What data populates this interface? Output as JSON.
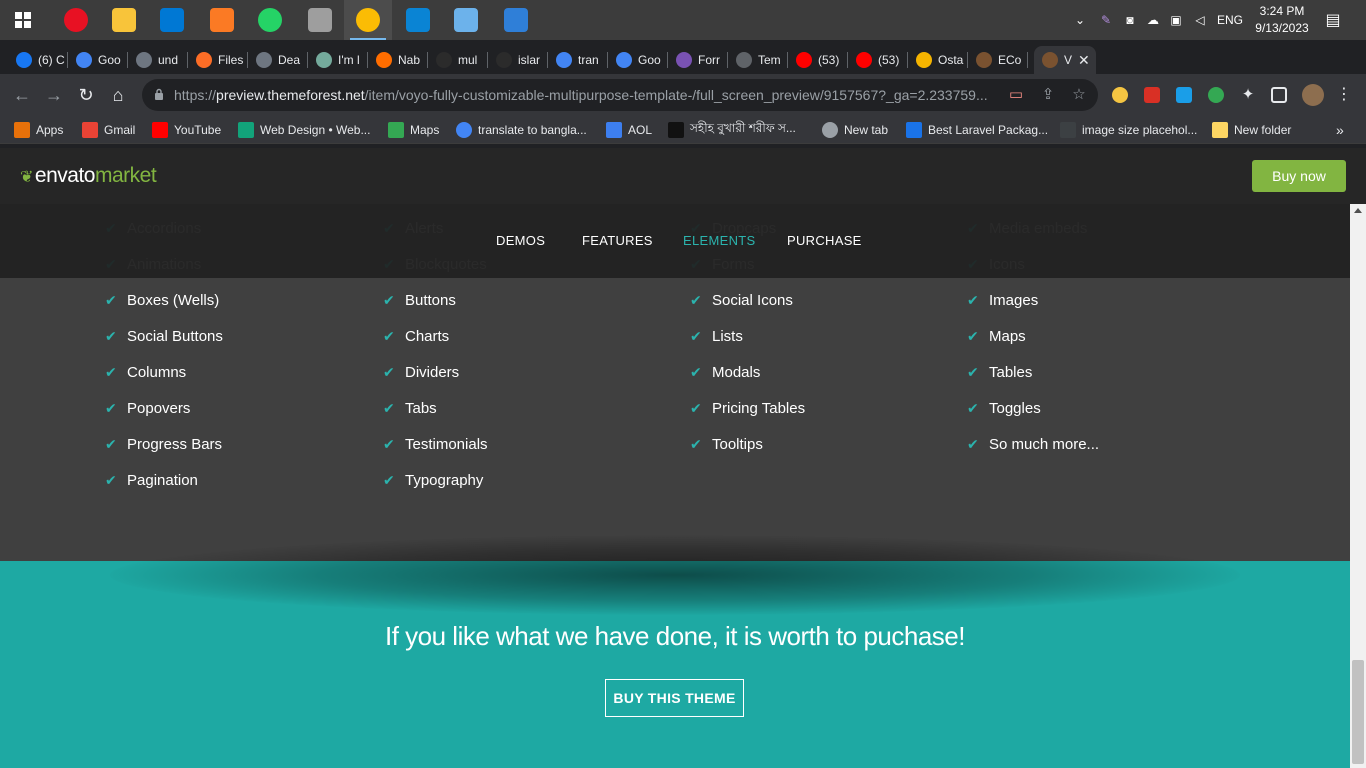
{
  "taskbar": {
    "apps": [
      {
        "name": "Start",
        "icon": "windows-icon"
      },
      {
        "name": "Screen recorder",
        "icon": "record-icon",
        "color": "#e81123"
      },
      {
        "name": "File Explorer",
        "icon": "folder-icon",
        "color": "#f8c43a"
      },
      {
        "name": "Microsoft Store",
        "icon": "store-icon",
        "color": "#0078d4"
      },
      {
        "name": "XAMPP",
        "icon": "xampp-icon",
        "color": "#fb7a24"
      },
      {
        "name": "WhatsApp",
        "icon": "whatsapp-icon",
        "color": "#25d366"
      },
      {
        "name": "Printer",
        "icon": "printer-icon",
        "color": "#9e9e9e"
      },
      {
        "name": "Chrome",
        "icon": "chrome-icon",
        "color": "#fbbc04"
      },
      {
        "name": "VS Code",
        "icon": "vscode-icon",
        "color": "#0a84d4"
      },
      {
        "name": "Notepad",
        "icon": "notepad-icon",
        "color": "#6cb2eb"
      },
      {
        "name": "Photos",
        "icon": "photos-icon",
        "color": "#2f7fd8"
      }
    ],
    "tray": {
      "language": "ENG",
      "time": "3:24 PM",
      "date": "9/13/2023"
    }
  },
  "tabs": [
    {
      "label": "(6) C",
      "icon": "facebook-icon",
      "color": "#1877f2"
    },
    {
      "label": "Goo",
      "icon": "google-icon",
      "color": "#4285f4"
    },
    {
      "label": "und",
      "icon": "github-icon",
      "color": "#6e7681"
    },
    {
      "label": "Files",
      "icon": "gitlab-icon",
      "color": "#fc6d26"
    },
    {
      "label": "Dea",
      "icon": "github-icon",
      "color": "#6e7681"
    },
    {
      "label": "I'm l",
      "icon": "chatgpt-icon",
      "color": "#74aa9c"
    },
    {
      "label": "Nab",
      "icon": "fire-icon",
      "color": "#ff6d00"
    },
    {
      "label": "mul",
      "icon": "dark-icon",
      "color": "#2b2b2b"
    },
    {
      "label": "islar",
      "icon": "dark-icon",
      "color": "#2b2b2b"
    },
    {
      "label": "tran",
      "icon": "google-icon",
      "color": "#4285f4"
    },
    {
      "label": "Goo",
      "icon": "translate-icon",
      "color": "#4285f4"
    },
    {
      "label": "Forr",
      "icon": "bootstrap-icon",
      "color": "#7952b3"
    },
    {
      "label": "Tem",
      "icon": "globe-icon",
      "color": "#5f6368"
    },
    {
      "label": "(53)",
      "icon": "youtube-icon",
      "color": "#ff0000"
    },
    {
      "label": "(53)",
      "icon": "youtube-icon",
      "color": "#ff0000"
    },
    {
      "label": "Osta",
      "icon": "ostad-icon",
      "color": "#f5b400"
    },
    {
      "label": "ECo",
      "icon": "themeforest-icon",
      "color": "#7a5230"
    },
    {
      "label": "V",
      "icon": "themeforest-icon",
      "color": "#7a5230",
      "active": true
    }
  ],
  "toolbar": {
    "url_prefix": "https://",
    "url_host": "preview.themeforest.net",
    "url_path": "/item/voyo-fully-customizable-multipurpose-template-/full_screen_preview/9157567?_ga=2.233759..."
  },
  "bookmarks": [
    {
      "label": "Apps",
      "icon": "apps-grid-icon",
      "color": "#e8710a"
    },
    {
      "label": "Gmail",
      "icon": "gmail-icon",
      "color": "#ea4335"
    },
    {
      "label": "YouTube",
      "icon": "youtube-icon",
      "color": "#ff0000"
    },
    {
      "label": "Web Design • Web...",
      "icon": "webdesign-icon",
      "color": "#12a37a"
    },
    {
      "label": "Maps",
      "icon": "maps-icon",
      "color": "#34a853"
    },
    {
      "label": "translate to bangla...",
      "icon": "google-icon",
      "color": "#4285f4"
    },
    {
      "label": "AOL",
      "icon": "aol-icon",
      "color": "#3d7ff0"
    },
    {
      "label": "সহীহ বুখারী শরীফ স...",
      "icon": "book-icon",
      "color": "#111111"
    },
    {
      "label": "New tab",
      "icon": "globe-icon",
      "color": "#9aa0a6"
    },
    {
      "label": "Best Laravel Packag...",
      "icon": "laravel-icon",
      "color": "#1a73e8"
    },
    {
      "label": "image size placehol...",
      "icon": "image-icon",
      "color": "#3c4043"
    },
    {
      "label": "New folder",
      "icon": "folder-icon",
      "color": "#fdd663"
    }
  ],
  "envato": {
    "logo_main": "envato",
    "logo_accent": "market",
    "buy_now": "Buy now",
    "accent": "#82b541"
  },
  "site_nav": [
    {
      "label": "DEMOS"
    },
    {
      "label": "FEATURES"
    },
    {
      "label": "ELEMENTS",
      "active": true
    },
    {
      "label": "PURCHASE"
    }
  ],
  "elements": {
    "col1": [
      "Accordions",
      "Animations",
      "Boxes (Wells)",
      "Social Buttons",
      "Columns",
      "Popovers",
      "Progress Bars",
      "Pagination"
    ],
    "col2": [
      "Alerts",
      "Blockquotes",
      "Buttons",
      "Charts",
      "Dividers",
      "Tabs",
      "Testimonials",
      "Typography"
    ],
    "col3": [
      "Dropcaps",
      "Forms",
      "Social Icons",
      "Lists",
      "Modals",
      "Pricing Tables",
      "Tooltips"
    ],
    "col4": [
      "Media embeds",
      "Icons",
      "Images",
      "Maps",
      "Tables",
      "Toggles",
      "So much more..."
    ]
  },
  "cta": {
    "text": "If you like what we have done, it is worth to puchase!",
    "button": "BUY THIS THEME",
    "accent": "#1ea9a3"
  }
}
